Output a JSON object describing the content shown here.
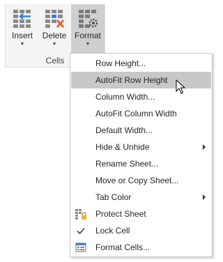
{
  "ribbon": {
    "insert_label": "Insert",
    "delete_label": "Delete",
    "format_label": "Format",
    "group_label": "Cells"
  },
  "menu": {
    "items": [
      {
        "label": "Row Height..."
      },
      {
        "label": "AutoFit Row Height"
      },
      {
        "label": "Column Width..."
      },
      {
        "label": "AutoFit Column Width"
      },
      {
        "label": "Default Width..."
      },
      {
        "label": "Hide & Unhide"
      },
      {
        "label": "Rename Sheet..."
      },
      {
        "label": "Move or Copy Sheet..."
      },
      {
        "label": "Tab Color"
      },
      {
        "label": "Protect Sheet"
      },
      {
        "label": "Lock Cell"
      },
      {
        "label": "Format Cells..."
      }
    ]
  },
  "colors": {
    "highlight": "#c8c8c8",
    "delete_x": "#e8572b",
    "insert_arrow": "#3a7fd5"
  }
}
